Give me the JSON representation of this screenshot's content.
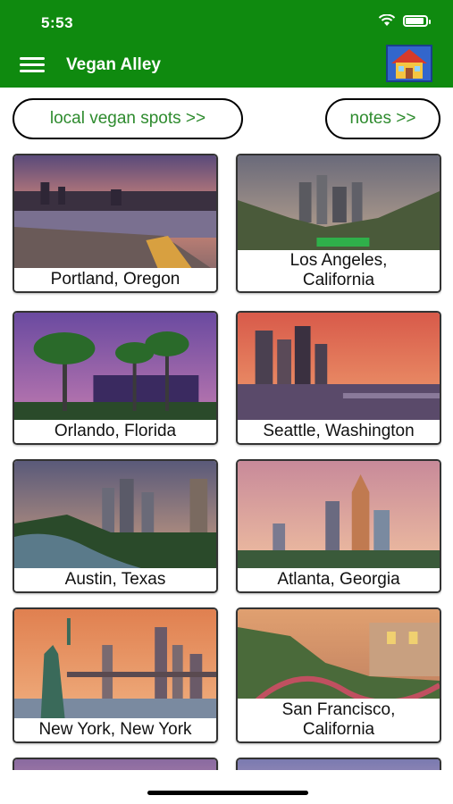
{
  "status_bar": {
    "time": "5:53"
  },
  "header": {
    "title": "Vegan Alley"
  },
  "buttons": {
    "local_spots": "local vegan spots >>",
    "notes": "notes >>"
  },
  "cities": [
    {
      "label": "Portland, Oregon"
    },
    {
      "label": "Los Angeles,\nCalifornia"
    },
    {
      "label": "Orlando, Florida"
    },
    {
      "label": "Seattle, Washington"
    },
    {
      "label": "Austin, Texas"
    },
    {
      "label": "Atlanta, Georgia"
    },
    {
      "label": "New York, New York"
    },
    {
      "label": "San Francisco,\nCalifornia"
    }
  ],
  "colors": {
    "header": "#0f8a0f",
    "button_text": "#2e8b2e"
  }
}
